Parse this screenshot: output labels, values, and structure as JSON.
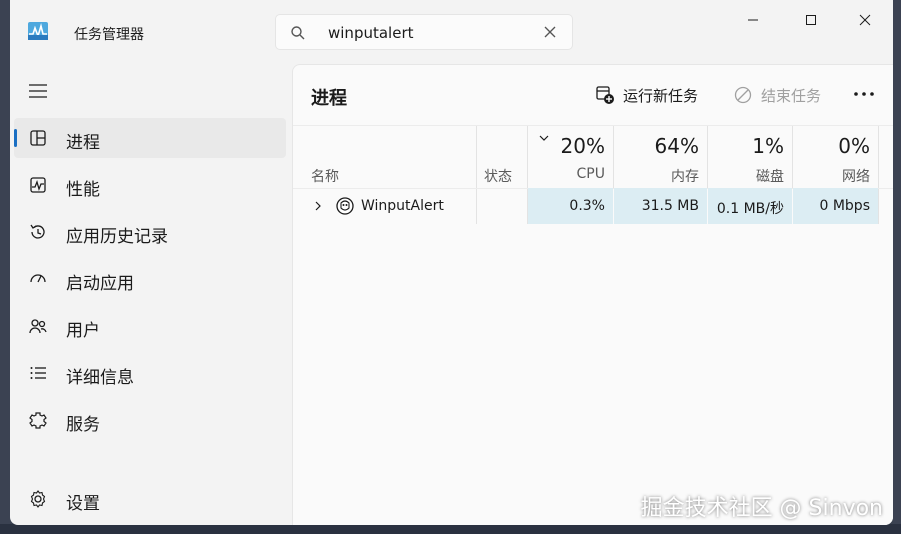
{
  "window": {
    "title": "任务管理器"
  },
  "search": {
    "value": "winputalert"
  },
  "window_controls": {
    "minimize_icon": "minimize-icon",
    "maximize_icon": "maximize-icon",
    "close_icon": "close-icon"
  },
  "sidebar": {
    "items": [
      {
        "label": "进程",
        "icon": "processes-icon",
        "selected": true
      },
      {
        "label": "性能",
        "icon": "performance-icon"
      },
      {
        "label": "应用历史记录",
        "icon": "app-history-icon"
      },
      {
        "label": "启动应用",
        "icon": "startup-apps-icon"
      },
      {
        "label": "用户",
        "icon": "users-icon"
      },
      {
        "label": "详细信息",
        "icon": "details-icon"
      },
      {
        "label": "服务",
        "icon": "services-icon"
      }
    ],
    "settings": {
      "label": "设置",
      "icon": "gear-icon"
    }
  },
  "main": {
    "title": "进程",
    "run_new_task": "运行新任务",
    "end_task": "结束任务",
    "columns": {
      "name": "名称",
      "status": "状态",
      "cpu": {
        "pct": "20%",
        "label": "CPU"
      },
      "memory": {
        "pct": "64%",
        "label": "内存"
      },
      "disk": {
        "pct": "1%",
        "label": "磁盘"
      },
      "network": {
        "pct": "0%",
        "label": "网络"
      }
    },
    "rows": [
      {
        "name": "WinputAlert",
        "status": "",
        "cpu": "0.3%",
        "memory": "31.5 MB",
        "disk": "0.1 MB/秒",
        "network": "0 Mbps"
      }
    ]
  },
  "watermark": "掘金技术社区 @ Sinvon",
  "colors": {
    "accent": "#1a6fc3",
    "heat": "#dcedf3",
    "window_bg": "#f3f3f3"
  }
}
